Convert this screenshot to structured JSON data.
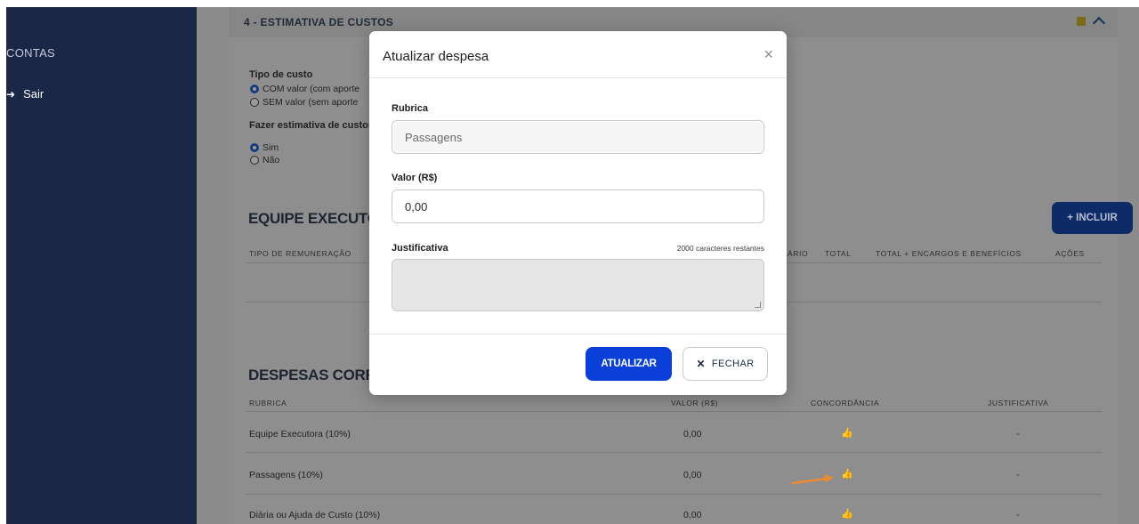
{
  "sidebar": {
    "section_label": "CONTAS",
    "exit_icon": "sign-out-icon",
    "exit_label": "Sair"
  },
  "card": {
    "title": "4 - ESTIMATIVA DE CUSTOS",
    "cost_type_label": "Tipo de custo",
    "cost_type_options": [
      "COM valor (com aporte",
      "SEM valor (sem aporte"
    ],
    "cost_type_selected": "COM valor (com aporte",
    "estimate_label": "Fazer estimativa de custos",
    "estimate_options": [
      "Sim",
      "Não"
    ],
    "estimate_selected": "Sim"
  },
  "team": {
    "heading": "EQUIPE EXECUTORA",
    "include_button": "+ INCLUIR",
    "columns": [
      "TIPO DE REMUNERAÇÃO",
      "ÁRIO",
      "TOTAL",
      "TOTAL + ENCARGOS E BENEFÍCIOS",
      "AÇÕES"
    ]
  },
  "expenses": {
    "heading": "DESPESAS CORRENT",
    "columns": [
      "RUBRICA",
      "VALOR (R$)",
      "CONCORDÂNCIA",
      "JUSTIFICATIVA"
    ],
    "rows": [
      {
        "rubrica": "Equipe Executora (10%)",
        "valor": "0,00",
        "concordancia": "thumbs-up-icon",
        "justificativa": "-"
      },
      {
        "rubrica": "Passagens (10%)",
        "valor": "0,00",
        "concordancia": "thumbs-up-icon",
        "justificativa": "-"
      },
      {
        "rubrica": "Diária ou Ajuda de Custo (10%)",
        "valor": "0,00",
        "concordancia": "thumbs-up-icon",
        "justificativa": "-"
      }
    ]
  },
  "modal": {
    "title": "Atualizar despesa",
    "close_symbol": "×",
    "rubrica_label": "Rubrica",
    "rubrica_value": "Passagens",
    "valor_label": "Valor (R$)",
    "valor_value": "0,00",
    "justificativa_label": "Justificativa",
    "char_counter": "2000 caracteres restantes",
    "update_button": "ATUALIZAR",
    "close_button": "FECHAR"
  },
  "colors": {
    "sidebar": "#1a2747",
    "primary_button": "#0a3fd8",
    "arrow": "#f08a30"
  }
}
